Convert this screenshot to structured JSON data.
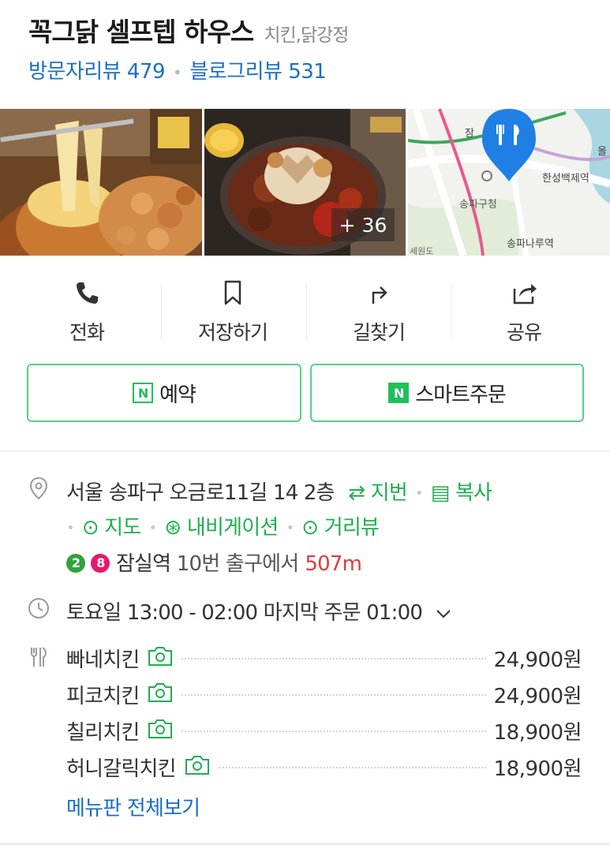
{
  "header": {
    "place_name": "꼭그닭 셀프텝 하우스",
    "category": "치킨,닭강정",
    "visitor_review_label": "방문자리뷰",
    "visitor_review_count": "479",
    "blog_review_label": "블로그리뷰",
    "blog_review_count": "531"
  },
  "photos": {
    "more_count": "+ 36",
    "map_labels": {
      "station_top": "잠",
      "station_right": "올",
      "hanseong": "한성백제역",
      "songpa_office": "송파구청",
      "songpanaru": "송파나루역",
      "corner": "세원도"
    }
  },
  "actions": [
    {
      "label": "전화",
      "icon": "phone-icon"
    },
    {
      "label": "저장하기",
      "icon": "bookmark-icon"
    },
    {
      "label": "길찾기",
      "icon": "directions-icon"
    },
    {
      "label": "공유",
      "icon": "share-icon"
    }
  ],
  "booking": {
    "reserve_label": "예약",
    "smart_order_label": "스마트주문",
    "badge": "N"
  },
  "address": {
    "text": "서울 송파구 오금로11길 14 2층",
    "jibun_label": "지번",
    "copy_label": "복사",
    "map_label": "지도",
    "navigation_label": "내비게이션",
    "street_view_label": "거리뷰"
  },
  "subway": {
    "lines": [
      {
        "number": "2",
        "color": "#33a23d"
      },
      {
        "number": "8",
        "color": "#e6186c"
      }
    ],
    "station": "잠실역",
    "exit_text": "10번 출구에서",
    "distance": "507m"
  },
  "hours": {
    "text": "토요일 13:00 - 02:00 마지막 주문 01:00"
  },
  "menu": {
    "items": [
      {
        "name": "빠네치킨",
        "price": "24,900원"
      },
      {
        "name": "피코치킨",
        "price": "24,900원"
      },
      {
        "name": "칠리치킨",
        "price": "18,900원"
      },
      {
        "name": "허니갈릭치킨",
        "price": "18,900원"
      }
    ],
    "view_all_label": "메뉴판 전체보기"
  },
  "colors": {
    "link_blue": "#1b6fc2",
    "naver_green": "#1fbf5b",
    "distance_red": "#e23c3c"
  }
}
